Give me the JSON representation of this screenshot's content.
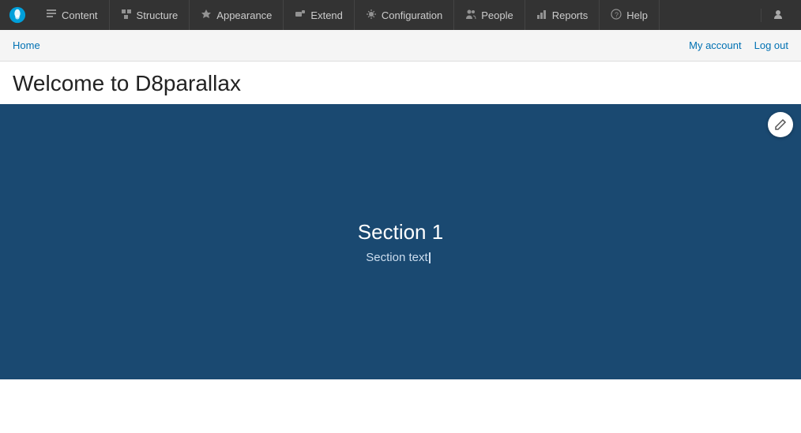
{
  "toolbar": {
    "logo_label": "Drupal",
    "nav_items": [
      {
        "id": "content",
        "label": "Content",
        "icon": "📄"
      },
      {
        "id": "structure",
        "label": "Structure",
        "icon": "🏗"
      },
      {
        "id": "appearance",
        "label": "Appearance",
        "icon": "🎨"
      },
      {
        "id": "extend",
        "label": "Extend",
        "icon": "🧩"
      },
      {
        "id": "configuration",
        "label": "Configuration",
        "icon": "⚙"
      },
      {
        "id": "people",
        "label": "People",
        "icon": "👥"
      },
      {
        "id": "reports",
        "label": "Reports",
        "icon": "📊"
      },
      {
        "id": "help",
        "label": "Help",
        "icon": "❓"
      }
    ]
  },
  "secondary_bar": {
    "home_label": "Home",
    "my_account_label": "My account",
    "log_out_label": "Log out"
  },
  "page": {
    "title": "Welcome to D8parallax",
    "hero": {
      "section_title": "Section 1",
      "section_text": "Section text"
    }
  }
}
